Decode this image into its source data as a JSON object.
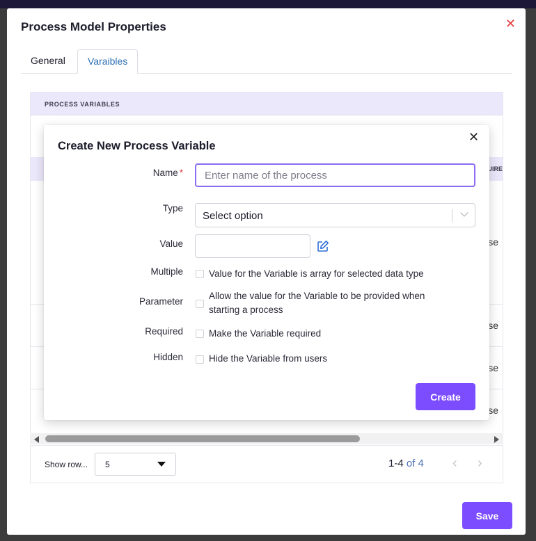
{
  "dialog": {
    "title": "Process Model Properties",
    "close_glyph": "✕",
    "tabs": [
      {
        "label": "General",
        "active": false
      },
      {
        "label": "Varaibles",
        "active": true
      }
    ],
    "section_header": "PROCESS VARIABLES",
    "column_partial": "UIRE",
    "row_partials": [
      "se",
      "se",
      "se",
      "se"
    ],
    "pagination": {
      "show_rows_label": "Show row...",
      "rows_per_page": "5",
      "range": "1-4",
      "of_total": "of 4",
      "prev_glyph": "‹",
      "next_glyph": "›"
    },
    "save_label": "Save"
  },
  "modal": {
    "title": "Create New Process Variable",
    "close_glyph": "✕",
    "fields": {
      "name_label": "Name",
      "name_required_mark": "*",
      "name_placeholder": "Enter name of the process",
      "type_label": "Type",
      "type_value": "Select option",
      "value_label": "Value",
      "value_value": "",
      "multiple_label": "Multiple",
      "multiple_text": "Value for the Variable is array for selected data type",
      "parameter_label": "Parameter",
      "parameter_text_line1": "Allow the value for the Variable to be provided when",
      "parameter_text_line2": "starting a process",
      "required_label": "Required",
      "required_text": "Make the Variable required",
      "hidden_label": "Hidden",
      "hidden_text": "Hide the Variable from users"
    },
    "create_label": "Create"
  },
  "colors": {
    "accent": "#7c4dff",
    "focus_border": "#8b6cf2",
    "header_bg": "#ece8fb",
    "close_red": "#e23b3b",
    "tab_active": "#2e6fb4"
  }
}
